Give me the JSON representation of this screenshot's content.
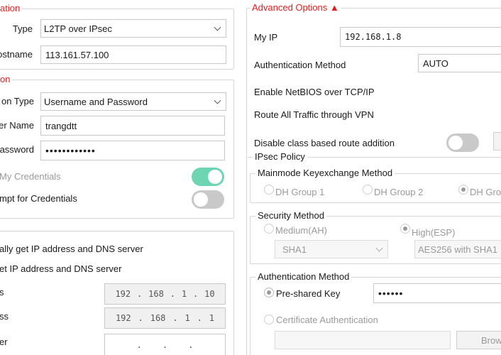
{
  "connection": {
    "legend": "ation",
    "type_label": "Type",
    "type_value": "L2TP over IPsec",
    "hostname_label": "ostname",
    "hostname_value": "113.161.57.100"
  },
  "authentication": {
    "legend": "on",
    "auth_type_label": "on Type",
    "auth_type_value": "Username and Password",
    "user_name_label": "er Name",
    "user_name_value": "trangdtt",
    "password_label": "assword",
    "password_value": "••••••••••••",
    "remember_label": "My Credentials",
    "remember_on": true,
    "prompt_label": "mpt for Credentials",
    "prompt_on": false
  },
  "ip_settings": {
    "auto_label": "ally get IP address and DNS server",
    "manual_label": "et IP address and DNS server",
    "ip_label": "s",
    "ip_value": [
      "192",
      "168",
      "1",
      "10"
    ],
    "gateway_label": "ss",
    "gateway_value": [
      "192",
      "168",
      "1",
      "1"
    ],
    "dns_label": "er",
    "dns_value": [
      ".",
      ".",
      "."
    ]
  },
  "advanced": {
    "legend": "Advanced Options ▲",
    "my_ip_label": "My IP",
    "my_ip_value": "192.168.1.8",
    "auth_method_label": "Authentication Method",
    "auth_method_value": "AUTO",
    "netbios_label": "Enable NetBIOS over TCP/IP",
    "route_all_label": "Route All Traffic through VPN",
    "disable_class_label": "Disable class based route addition",
    "disable_class_on": false
  },
  "ipsec": {
    "legend": "IPsec Policy",
    "mainmode": {
      "legend": "Mainmode Keyexchange Method",
      "options": [
        "DH Group 1",
        "DH Group 2",
        "DH Gro"
      ],
      "selected": 2
    },
    "security": {
      "legend": "Security Method",
      "medium_label": "Medium(AH)",
      "high_label": "High(ESP)",
      "medium_select": "SHA1",
      "high_select": "AES256 with SHA1"
    },
    "auth": {
      "legend": "Authentication Method",
      "psk_label": "Pre-shared Key",
      "psk_value": "••••••",
      "cert_label": "Certificate Authentication",
      "browse_label": "Brow"
    }
  },
  "colors": {
    "accent_red": "#e02020",
    "toggle_on": "#6dd5b2",
    "toggle_off": "#c9c9c9"
  }
}
